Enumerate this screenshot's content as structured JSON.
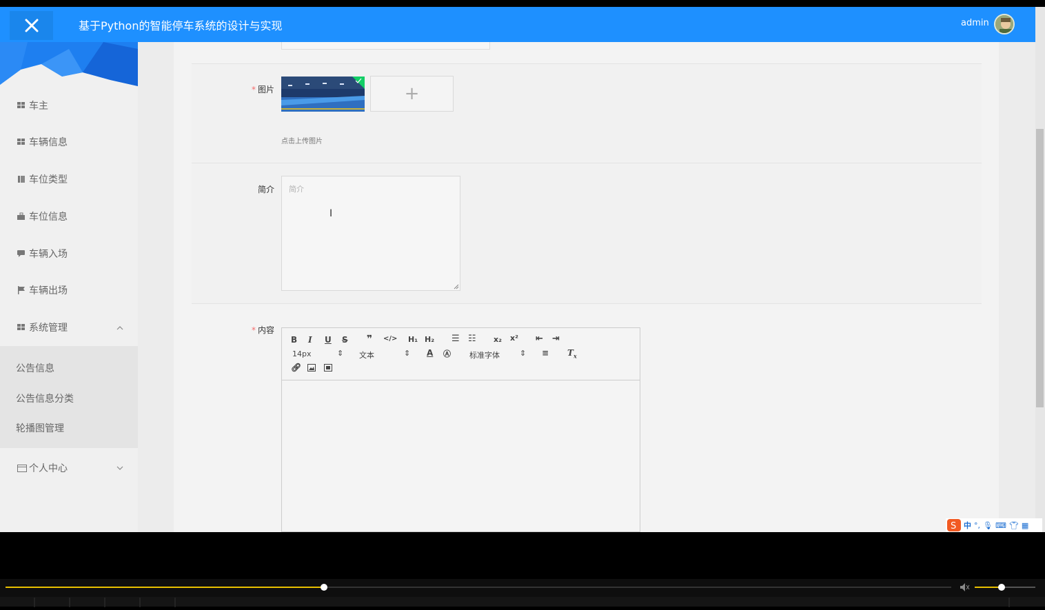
{
  "header": {
    "title": "基于Python的智能停车系统的设计与实现",
    "user": "admin"
  },
  "sidebar": {
    "items": [
      {
        "label": "车主",
        "icon": "grid-icon"
      },
      {
        "label": "车辆信息",
        "icon": "grid-icon"
      },
      {
        "label": "车位类型",
        "icon": "book-icon"
      },
      {
        "label": "车位信息",
        "icon": "briefcase-icon"
      },
      {
        "label": "车辆入场",
        "icon": "comment-icon"
      },
      {
        "label": "车辆出场",
        "icon": "flag-icon"
      },
      {
        "label": "系统管理",
        "icon": "grid-icon",
        "expanded": true
      },
      {
        "label": "个人中心",
        "icon": "calendar-icon",
        "expanded": false
      }
    ],
    "submenu": [
      "公告信息",
      "公告信息分类",
      "轮播图管理"
    ]
  },
  "form": {
    "image_label": "图片",
    "upload_hint": "点击上传图片",
    "intro_label": "简介",
    "intro_placeholder": "简介",
    "content_label": "内容"
  },
  "editor": {
    "font_size": "14px",
    "text_style": "文本",
    "font_family": "标准字体"
  },
  "colors": {
    "header": "#1e90ff",
    "required": "#f56c6c",
    "progress": "#e8c000"
  },
  "player": {
    "progress_fraction": 0.337,
    "volume_fraction": 0.44
  },
  "ime": {
    "mode": "中"
  }
}
